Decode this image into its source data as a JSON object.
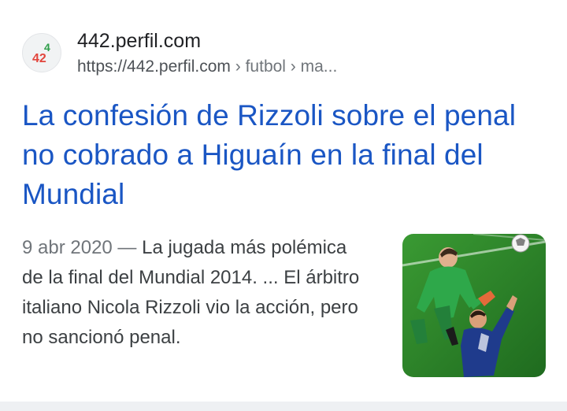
{
  "result": {
    "site_name": "442.perfil.com",
    "url_base": "https://442.perfil.com",
    "url_path": " › futbol › ma...",
    "favicon_text_top": "4",
    "favicon_text_bottom": "42",
    "title": "La confesión de Rizzoli sobre el penal no cobrado a Higuaín en la final del Mundial",
    "date": "9 abr 2020 —",
    "snippet": " La jugada más polémica de la final del Mundial 2014. ... El árbitro italiano Nicola Rizzoli vio la acción, pero no sancionó penal."
  },
  "colors": {
    "title_link": "#1a56c4",
    "text": "#3c4043",
    "muted": "#70757a",
    "pitch": "#2f8a2a",
    "keeper_kit": "#2ea84a",
    "player_kit": "#1f3b8c"
  },
  "icons": {
    "favicon": "442-logo-icon",
    "thumbnail": "football-match-photo"
  }
}
